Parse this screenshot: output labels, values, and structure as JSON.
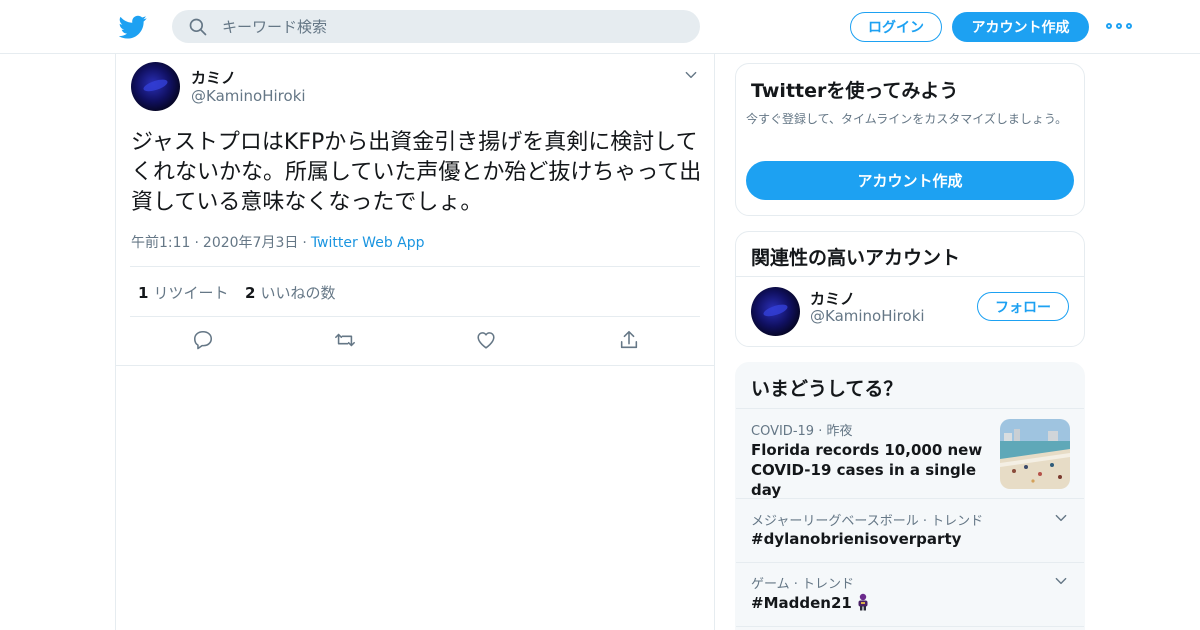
{
  "header": {
    "search_placeholder": "キーワード検索",
    "login_label": "ログイン",
    "signup_label": "アカウント作成"
  },
  "tweet": {
    "display_name": "カミノ",
    "handle": "@KaminoHiroki",
    "text": "ジャストプロはKFPから出資金引き揚げを真剣に検討してくれないかな。所属していた声優とか殆ど抜けちゃって出資している意味なくなったでしょ。",
    "time": "午前1:11",
    "date": "2020年7月3日",
    "source": "Twitter Web App",
    "retweet_count": "1",
    "retweet_label": "リツイート",
    "like_count": "2",
    "like_label": "いいねの数"
  },
  "sidebar": {
    "try_card": {
      "title": "Twitterを使ってみよう",
      "description": "今すぐ登録して、タイムラインをカスタマイズしましょう。",
      "button_label": "アカウント作成"
    },
    "related": {
      "title": "関連性の高いアカウント",
      "display_name": "カミノ",
      "handle": "@KaminoHiroki",
      "follow_label": "フォロー"
    },
    "trends": {
      "title": "いまどうしてる？",
      "items": [
        {
          "category": "COVID-19",
          "time": "昨夜",
          "label": "Florida records 10,000 new COVID-19 cases in a single day"
        },
        {
          "category": "メジャーリーグベースボール · トレンド",
          "label": "#dylanobrienisoverparty"
        },
        {
          "category": "ゲーム · トレンド",
          "label": "#Madden21"
        }
      ]
    }
  },
  "colors": {
    "brand": "#1da1f2",
    "secondary_text": "#657786",
    "border": "#e6ecf0"
  }
}
